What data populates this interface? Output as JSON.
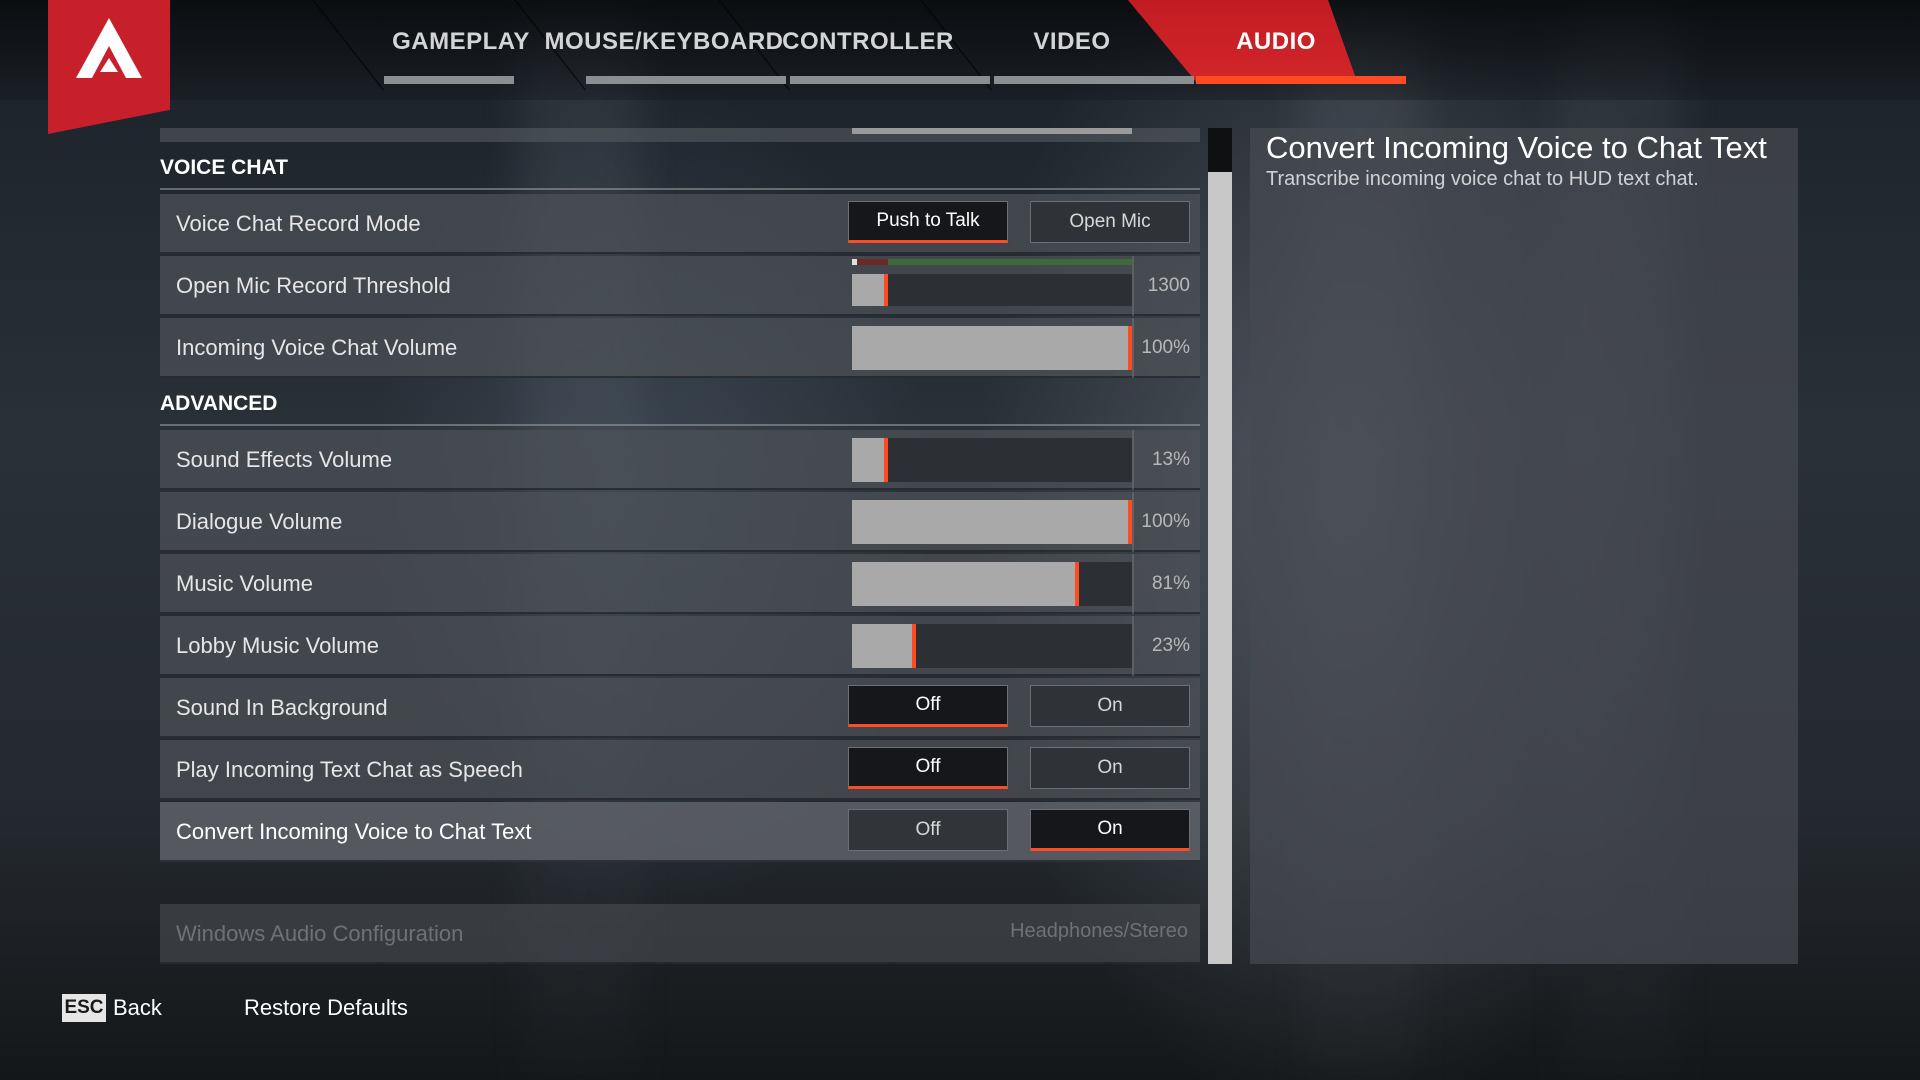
{
  "nav": {
    "tabs": [
      {
        "label": "GAMEPLAY",
        "active": false
      },
      {
        "label": "MOUSE/KEYBOARD",
        "active": false
      },
      {
        "label": "CONTROLLER",
        "active": false
      },
      {
        "label": "VIDEO",
        "active": false
      },
      {
        "label": "AUDIO",
        "active": true
      }
    ]
  },
  "sections": {
    "voice_chat": "VOICE CHAT",
    "advanced": "ADVANCED"
  },
  "settings": {
    "voice_record_mode": {
      "label": "Voice Chat Record Mode",
      "options": [
        "Push to Talk",
        "Open Mic"
      ],
      "selected": "Push to Talk"
    },
    "open_mic_threshold": {
      "label": "Open Mic Record Threshold",
      "value": "1300",
      "fraction": 0.13
    },
    "incoming_voice_volume": {
      "label": "Incoming Voice Chat Volume",
      "value": "100%",
      "fraction": 1.0
    },
    "sfx_volume": {
      "label": "Sound Effects Volume",
      "value": "13%",
      "fraction": 0.13
    },
    "dialogue_volume": {
      "label": "Dialogue Volume",
      "value": "100%",
      "fraction": 1.0
    },
    "music_volume": {
      "label": "Music Volume",
      "value": "81%",
      "fraction": 0.81
    },
    "lobby_music_volume": {
      "label": "Lobby Music Volume",
      "value": "23%",
      "fraction": 0.23
    },
    "sound_in_background": {
      "label": "Sound In Background",
      "options": [
        "Off",
        "On"
      ],
      "selected": "Off"
    },
    "text_chat_speech": {
      "label": "Play Incoming Text Chat as Speech",
      "options": [
        "Off",
        "On"
      ],
      "selected": "Off"
    },
    "voice_to_text": {
      "label": "Convert Incoming Voice to Chat Text",
      "options": [
        "Off",
        "On"
      ],
      "selected": "On"
    },
    "windows_audio": {
      "label": "Windows Audio Configuration",
      "value": "Headphones/Stereo"
    }
  },
  "description": {
    "title": "Convert Incoming Voice to Chat Text",
    "text": "Transcribe incoming voice chat to HUD text chat."
  },
  "footer": {
    "esc_key": "ESC",
    "back_label": "Back",
    "restore_label": "Restore Defaults"
  },
  "colors": {
    "accent": "#ff4a22",
    "brand_red": "#c8202a"
  },
  "icons": {
    "logo": "apex-logo-icon"
  }
}
